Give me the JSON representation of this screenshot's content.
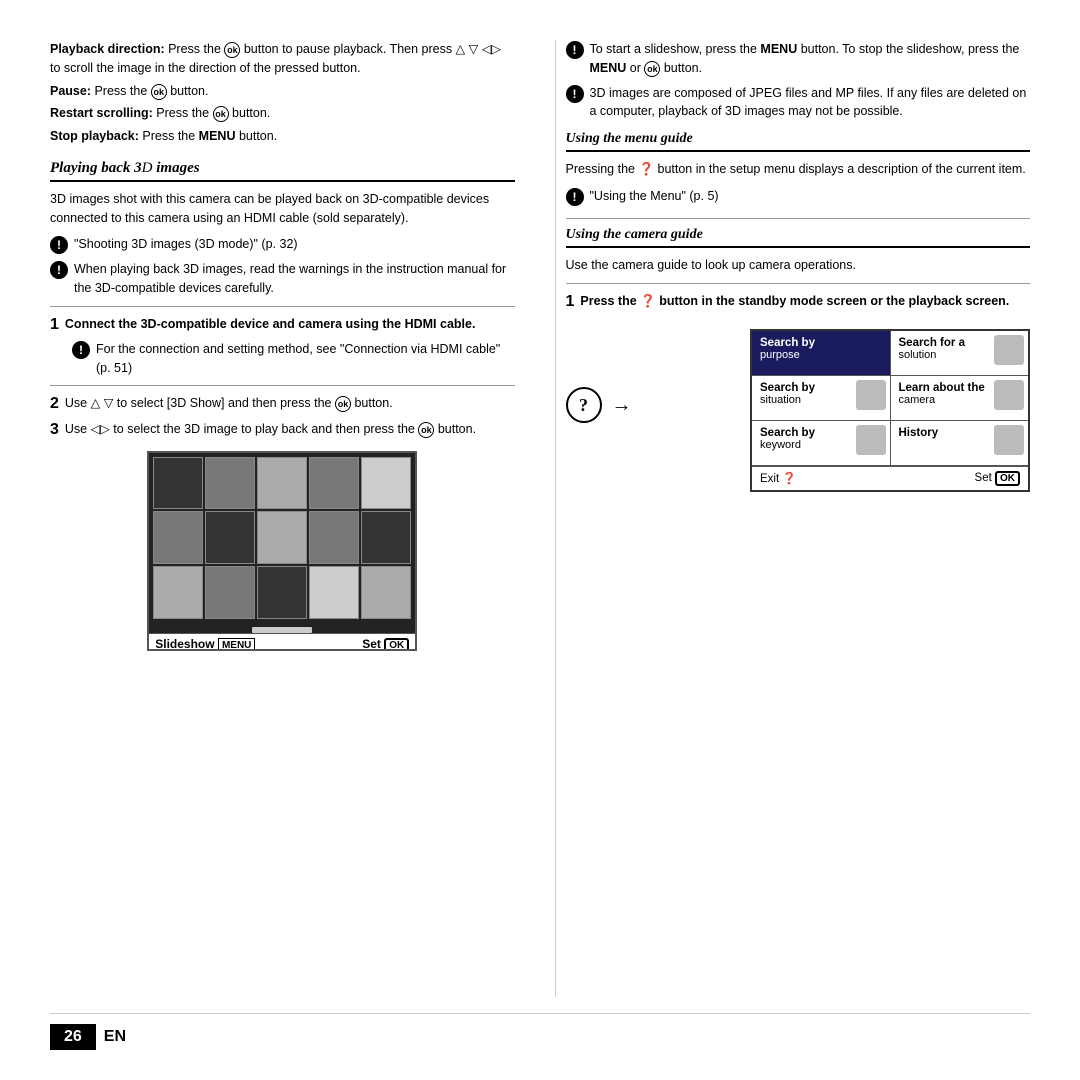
{
  "page": {
    "number": "26",
    "language": "EN"
  },
  "left": {
    "top_notes": [
      {
        "label": "Playback direction:",
        "text": " Press the Ⓞ button to pause playback. Then press △ ▽ ◁▷ to scroll the image in the direction of the pressed button."
      },
      {
        "label": "Pause:",
        "text": " Press the Ⓞ button."
      },
      {
        "label": "Restart scrolling:",
        "text": " Press the Ⓞ button."
      },
      {
        "label": "Stop playback:",
        "text": " Press the MENU button."
      }
    ],
    "section_title": "Playing back 3D images",
    "section_body": "3D images shot with this camera can be played back on 3D-compatible devices connected to this camera using an HDMI cable (sold separately).",
    "notes": [
      "“Shooting 3D images (3D mode)” (p. 32)",
      "When playing back 3D images, read the warnings in the instruction manual for the 3D-compatible devices carefully."
    ],
    "steps": [
      {
        "num": "1",
        "bold_text": "Connect the 3D-compatible device and camera using the HDMI cable.",
        "sub_note": "For the connection and setting method, see “Connection via HDMI cable” (p. 51)"
      },
      {
        "num": "2",
        "text": "Use △ ▽ to select [3D Show] and then press the Ⓞ button."
      },
      {
        "num": "3",
        "text": "Use ◁▷ to select the 3D image to play back and then press the Ⓞ button."
      }
    ],
    "slideshow": {
      "label": "Slideshow",
      "menu_label": "MENU",
      "set_label": "Set",
      "ok_label": "OK"
    }
  },
  "right": {
    "top_notes": [
      {
        "icon": "!",
        "text": "To start a slideshow, press the MENU button. To stop the slideshow, press the MENU or Ⓞ button."
      },
      {
        "icon": "!",
        "text": "3D images are composed of JPEG files and MP files. If any files are deleted on a computer, playback of 3D images may not be possible."
      }
    ],
    "menu_guide": {
      "title": "Using the menu guide",
      "body": "Pressing the ❓ button in the setup menu displays a description of the current item.",
      "note": "“Using the Menu” (p. 5)"
    },
    "camera_guide": {
      "title": "Using the camera guide",
      "body": "Use the camera guide to look up camera operations.",
      "step1": "Press the ❓ button in the standby mode screen or the playback screen.",
      "grid": {
        "cells": [
          {
            "label": "Search by",
            "sub": "purpose",
            "highlight": true,
            "has_icon": false
          },
          {
            "label": "Search for a",
            "sub": "solution",
            "highlight": false,
            "has_icon": true
          },
          {
            "label": "Search by",
            "sub": "situation",
            "highlight": false,
            "has_icon": true
          },
          {
            "label": "Learn about the",
            "sub": "camera",
            "highlight": false,
            "has_icon": true
          },
          {
            "label": "Search by",
            "sub": "keyword",
            "highlight": false,
            "has_icon": true
          },
          {
            "label": "History",
            "sub": "",
            "highlight": false,
            "has_icon": true
          }
        ],
        "footer_exit": "Exit",
        "footer_set": "Set"
      }
    }
  }
}
